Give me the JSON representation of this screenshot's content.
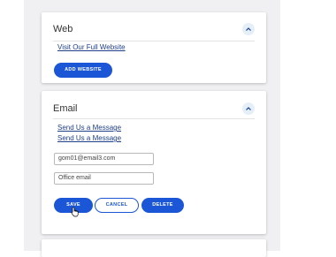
{
  "web_section": {
    "title": "Web",
    "link": "Visit Our Full Website",
    "add_button": "ADD WEBSITE"
  },
  "email_section": {
    "title": "Email",
    "links": [
      "Send Us a Message",
      "Send Us a Message"
    ],
    "email_value": "gom01@email3.com",
    "label_value": "Office email",
    "save_button": "SAVE",
    "cancel_button": "CANCEL",
    "delete_button": "DELETE"
  },
  "icons": {
    "collapse": "chevron-up-icon",
    "cursor": "hand-pointer-icon"
  },
  "colors": {
    "accent": "#1a56d6",
    "link": "#1f3f8a",
    "collapse_bg": "#e4eff8",
    "page_bg": "#f0f0f2"
  }
}
